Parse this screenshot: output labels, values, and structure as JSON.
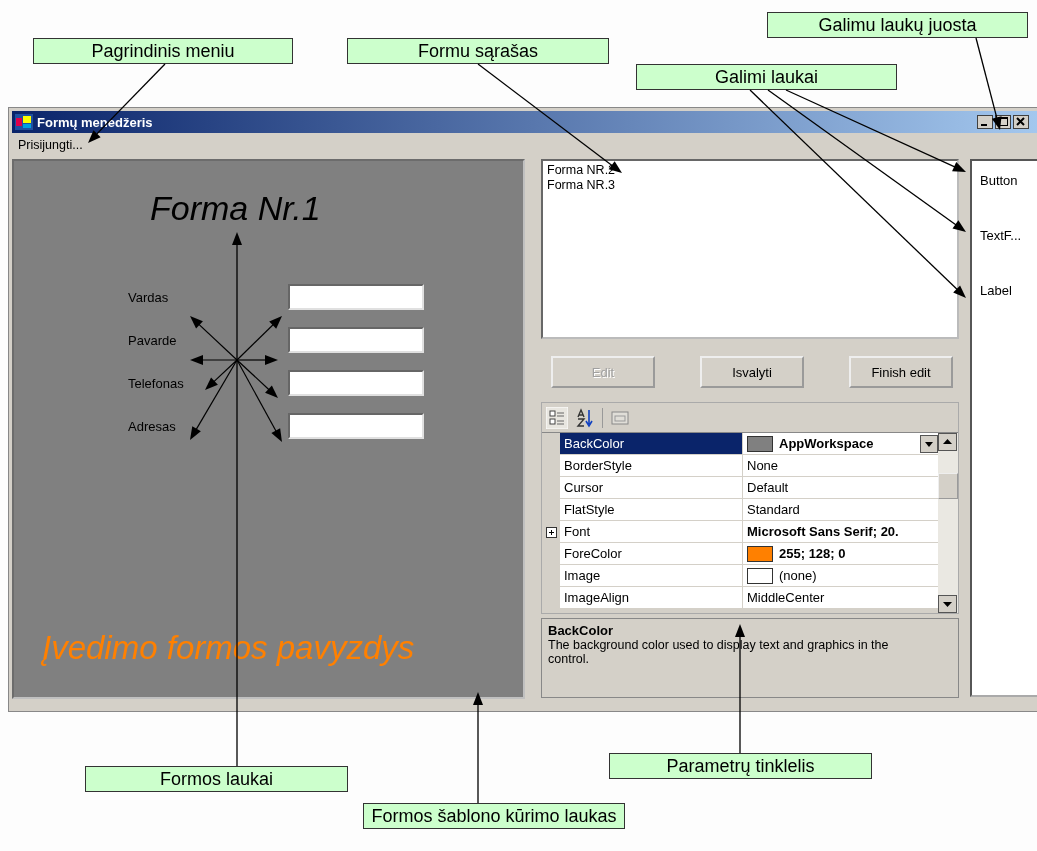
{
  "callouts": [
    {
      "text": "Pagrindinis meniu"
    },
    {
      "text": "Formu sąrašas"
    },
    {
      "text": "Galimi laukai"
    },
    {
      "text": "Galimu laukų juosta"
    },
    {
      "text": "Formos laukai"
    },
    {
      "text": "Formos šablono kūrimo laukas"
    },
    {
      "text": "Parametrų tinklelis"
    }
  ],
  "window": {
    "title": "Formų menedžeris"
  },
  "menu": [
    "Prisijungti..."
  ],
  "designer": {
    "title": "Forma Nr.1",
    "fields": [
      {
        "label": "Vardas"
      },
      {
        "label": "Pavarde"
      },
      {
        "label": "Telefonas"
      },
      {
        "label": "Adresas"
      }
    ],
    "caption": "Įvedimo formos pavyzdys"
  },
  "forms_list": [
    "Forma NR.2",
    "Forma NR.3"
  ],
  "buttons": [
    {
      "label": "Edit",
      "disabled": true
    },
    {
      "label": "Isvalyti",
      "disabled": false
    },
    {
      "label": "Finish edit",
      "disabled": false
    }
  ],
  "property_grid": {
    "rows": [
      {
        "name": "BackColor",
        "value": "AppWorkspace",
        "kind": "swatch",
        "color": "#808080",
        "bold": true,
        "selected": true,
        "expandable": false
      },
      {
        "name": "BorderStyle",
        "value": "None",
        "kind": "plain",
        "bold": false,
        "selected": false,
        "expandable": false
      },
      {
        "name": "Cursor",
        "value": "Default",
        "kind": "plain",
        "bold": false,
        "selected": false,
        "expandable": false
      },
      {
        "name": "FlatStyle",
        "value": "Standard",
        "kind": "plain",
        "bold": false,
        "selected": false,
        "expandable": false
      },
      {
        "name": "Font",
        "value": "Microsoft Sans Serif; 20.",
        "kind": "plain",
        "bold": true,
        "selected": false,
        "expandable": true
      },
      {
        "name": "ForeColor",
        "value": "255; 128; 0",
        "kind": "swatch",
        "color": "#ff8000",
        "bold": true,
        "selected": false,
        "expandable": false
      },
      {
        "name": "Image",
        "value": "(none)",
        "kind": "swatch",
        "color": "#ffffff",
        "bold": false,
        "selected": false,
        "expandable": false
      },
      {
        "name": "ImageAlign",
        "value": "MiddleCenter",
        "kind": "plain",
        "bold": false,
        "selected": false,
        "expandable": false
      }
    ],
    "description": {
      "title": "BackColor",
      "text": "The background color used to display text and graphics in the control."
    }
  },
  "toolbox": [
    "Button",
    "TextF...",
    "Label"
  ]
}
